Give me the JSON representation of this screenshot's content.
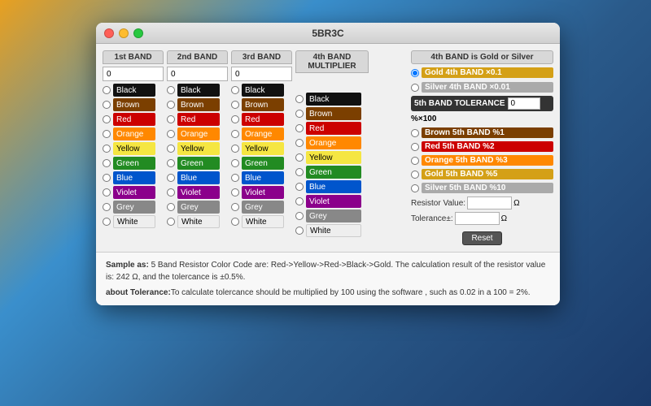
{
  "window": {
    "title": "5BR3C",
    "buttons": [
      "close",
      "minimize",
      "maximize"
    ]
  },
  "bands": [
    {
      "header": "1st BAND",
      "input_val": "0"
    },
    {
      "header": "2nd BAND",
      "input_val": "0"
    },
    {
      "header": "3rd BAND",
      "input_val": "0"
    },
    {
      "header": "4th BAND MULTIPLIER",
      "input_val": ""
    }
  ],
  "colors": [
    {
      "name": "Black",
      "class": "c-black"
    },
    {
      "name": "Brown",
      "class": "c-brown"
    },
    {
      "name": "Red",
      "class": "c-red"
    },
    {
      "name": "Orange",
      "class": "c-orange"
    },
    {
      "name": "Yellow",
      "class": "c-yellow"
    },
    {
      "name": "Green",
      "class": "c-green"
    },
    {
      "name": "Blue",
      "class": "c-blue"
    },
    {
      "name": "Violet",
      "class": "c-violet"
    },
    {
      "name": "Grey",
      "class": "c-grey"
    },
    {
      "name": "White",
      "class": "c-white"
    }
  ],
  "right_panel": {
    "header": "4th BAND is Gold or Silver",
    "gold_label": "Gold 4th BAND ×0.1",
    "silver_label": "Silver  4th BAND ×0.01",
    "tolerance_header": "5th BAND TOLERANCE",
    "tolerance_val": "0",
    "percent": "%×100",
    "band5_options": [
      {
        "label": "Brown 5th BAND %1",
        "class": "brown5"
      },
      {
        "label": "Red 5th BAND %2",
        "class": "red5"
      },
      {
        "label": "Orange 5th BAND %3",
        "class": "orange5"
      },
      {
        "label": "Gold 5th BAND %5",
        "class": "gold5"
      },
      {
        "label": "Silver 5th BAND %10",
        "class": "silver5"
      }
    ],
    "resistor_label": "Resistor Value:",
    "resistor_val": "",
    "tolerance_label": "Tolerance±:",
    "tolerance_result_val": "",
    "omega": "Ω",
    "reset_label": "Reset"
  },
  "footer": {
    "sample_bold": "Sample as:",
    "sample_text": " 5 Band Resistor Color Code are: Red->Yellow->Red->Black->Gold. The calculation result of the resistor value is: 242 Ω,  and the tolercance is ±0.5%.",
    "tolerance_bold": "about Tolerance:",
    "tolerance_text": "To calculate tolercance should be multiplied by 100 using the software , such as 0.02 in a 100 = 2%."
  }
}
